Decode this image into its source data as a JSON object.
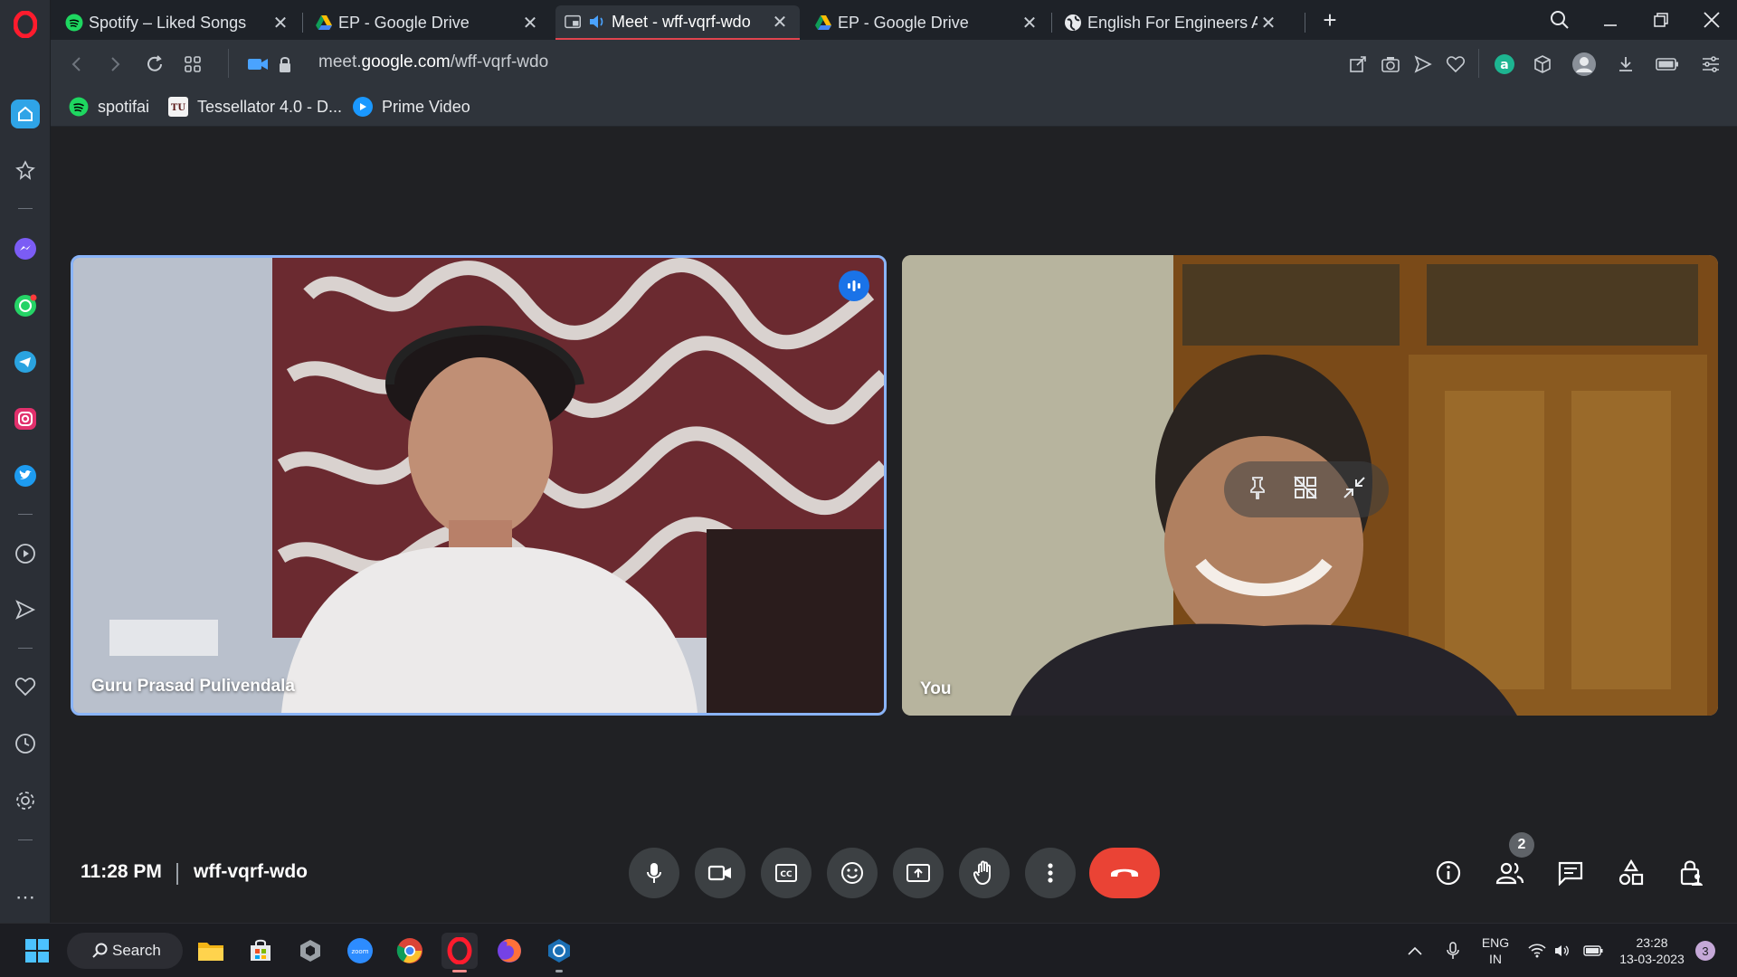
{
  "browser": {
    "tabs": [
      {
        "title": "Spotify – Liked Songs",
        "favicon": "spotify-icon"
      },
      {
        "title": "EP - Google Drive",
        "favicon": "google-drive-icon"
      },
      {
        "title": "Meet - wff-vqrf-wdo",
        "favicon": "meet-icon",
        "active": true
      },
      {
        "title": "EP - Google Drive",
        "favicon": "google-drive-icon"
      },
      {
        "title": "English For Engineers An",
        "favicon": "globe-icon"
      }
    ],
    "url_prefix": "meet.",
    "url_domain": "google.com",
    "url_path": "/wff-vqrf-wdo",
    "bookmarks": [
      {
        "label": "spotifai",
        "icon": "spotify-icon"
      },
      {
        "label": "Tessellator 4.0 - D...",
        "icon": "tu-icon"
      },
      {
        "label": "Prime Video",
        "icon": "prime-video-icon"
      }
    ]
  },
  "meet": {
    "participants": [
      {
        "name": "Guru Prasad Pulivendala",
        "speaking": true
      },
      {
        "name": "You",
        "speaking": false
      }
    ],
    "time": "11:28 PM",
    "meeting_code": "wff-vqrf-wdo",
    "people_count": "2"
  },
  "taskbar": {
    "search_label": "Search",
    "language_line1": "ENG",
    "language_line2": "IN",
    "time": "23:28",
    "date": "13-03-2023",
    "notification_count": "3"
  },
  "colors": {
    "accent_blue": "#1a73e8",
    "hangup_red": "#ea4335",
    "opera_red": "#e0444e",
    "meet_bg": "#202124"
  }
}
